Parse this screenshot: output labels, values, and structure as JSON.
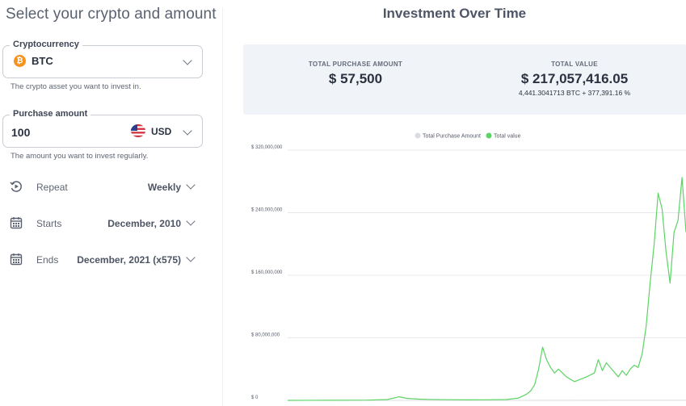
{
  "form": {
    "heading": "Select your crypto and amount",
    "crypto": {
      "legend": "Cryptocurrency",
      "value": "BTC",
      "icon": "bitcoin-icon",
      "helper": "The crypto asset you want to invest in."
    },
    "purchase": {
      "legend": "Purchase amount",
      "value": "100",
      "currency": "USD",
      "flag": "us-flag-icon",
      "helper": "The amount you want to invest regularly."
    },
    "options": [
      {
        "label": "Repeat",
        "value": "Weekly",
        "icon": "repeat-icon"
      },
      {
        "label": "Starts",
        "value": "December, 2010",
        "icon": "calendar-icon"
      },
      {
        "label": "Ends",
        "value": "December, 2021 (x575)",
        "icon": "calendar-icon"
      }
    ]
  },
  "results": {
    "heading": "Investment Over Time",
    "total_purchase_label": "TOTAL PURCHASE AMOUNT",
    "total_purchase_value": "$ 57,500",
    "total_value_label": "TOTAL VALUE",
    "total_value_value": "$ 217,057,416.05",
    "total_value_sub": "4,441.3041713 BTC   + 377,391.16 %"
  },
  "colors": {
    "accent_green": "#5cd465",
    "purchase_gray": "#d9dce2",
    "btc_orange": "#f7931a"
  },
  "chart_data": {
    "type": "line",
    "x_range": [
      "December, 2010",
      "December, 2021"
    ],
    "ylim": [
      0,
      320000000
    ],
    "y_ticks": [
      "$ 320,000,000",
      "$ 240,000,000",
      "$ 160,000,000",
      "$ 80,000,000",
      "$ 0"
    ],
    "grid": true,
    "legend_position": "top-center",
    "series": [
      {
        "name": "Total Purchase Amount",
        "color": "#d9dce2",
        "x": [
          0,
          100
        ],
        "values": [
          0,
          57500
        ]
      },
      {
        "name": "Total value",
        "color": "#5cd465",
        "x": [
          0,
          10,
          20,
          25,
          28,
          30,
          33,
          35,
          40,
          45,
          50,
          55,
          58,
          60,
          61,
          62,
          63,
          64,
          65,
          66,
          67,
          68,
          70,
          72,
          75,
          77,
          78,
          79,
          80,
          81,
          82,
          83,
          84,
          85,
          86,
          87,
          88,
          89,
          90,
          91,
          92,
          93,
          94,
          95,
          96,
          97,
          98,
          99,
          100
        ],
        "values": [
          0,
          100000,
          300000,
          1000000,
          4500000,
          2500000,
          1500000,
          1200000,
          800000,
          600000,
          700000,
          1000000,
          3000000,
          8000000,
          12000000,
          20000000,
          40000000,
          68000000,
          52000000,
          42000000,
          35000000,
          40000000,
          30000000,
          24000000,
          30000000,
          35000000,
          52000000,
          38000000,
          48000000,
          42000000,
          36000000,
          30000000,
          38000000,
          32000000,
          40000000,
          45000000,
          42000000,
          60000000,
          95000000,
          150000000,
          200000000,
          265000000,
          245000000,
          190000000,
          150000000,
          215000000,
          230000000,
          285000000,
          215000000
        ]
      }
    ]
  }
}
